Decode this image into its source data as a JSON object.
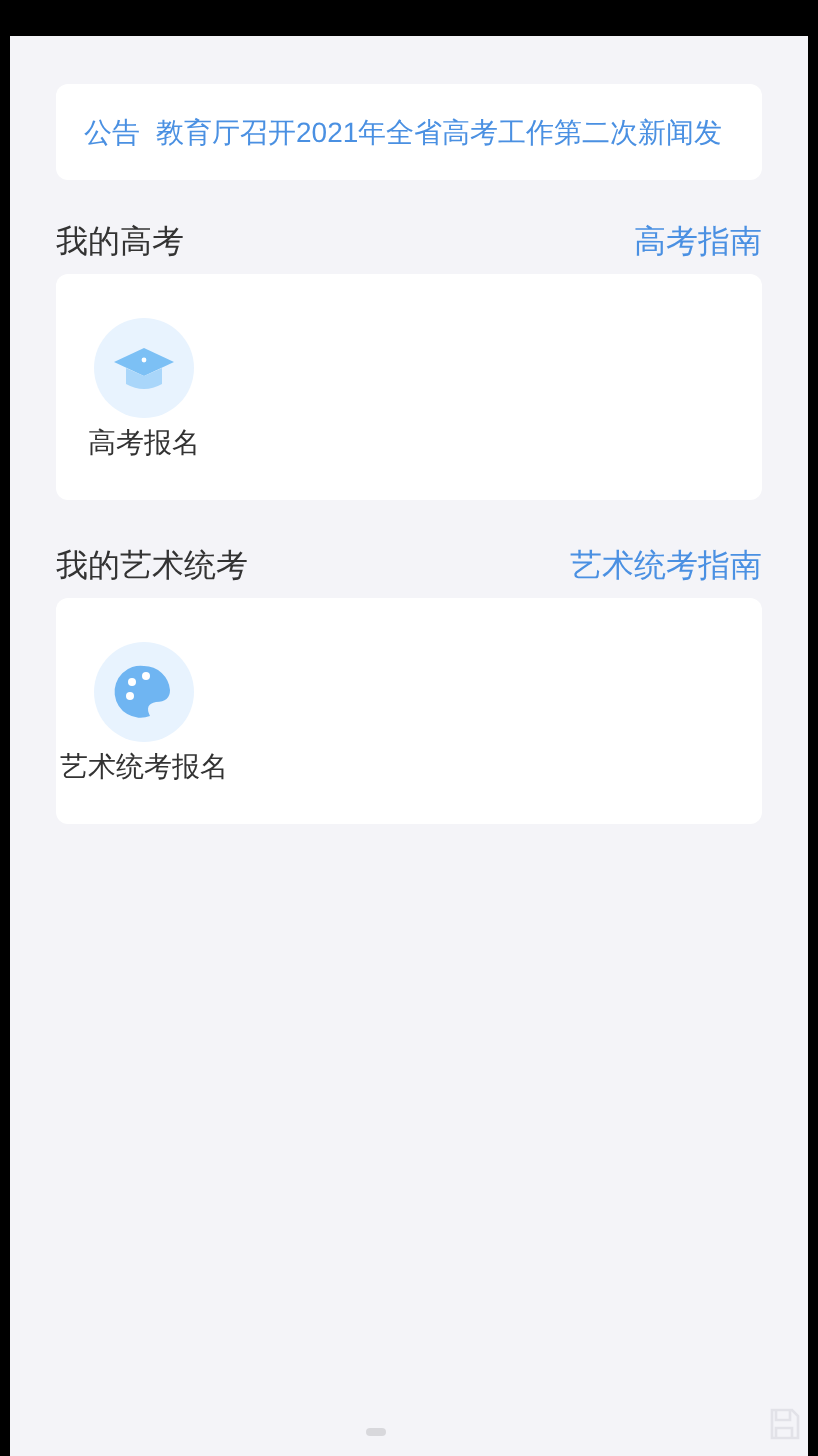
{
  "notice": {
    "tag": "公告",
    "text": "教育厅召开2021年全省高考工作第二次新闻发"
  },
  "sections": [
    {
      "title": "我的高考",
      "link": "高考指南",
      "items": [
        {
          "kind": "cap",
          "label": "高考报名"
        }
      ]
    },
    {
      "title": "我的艺术统考",
      "link": "艺术统考指南",
      "items": [
        {
          "kind": "palette",
          "label": "艺术统考报名"
        }
      ]
    }
  ]
}
